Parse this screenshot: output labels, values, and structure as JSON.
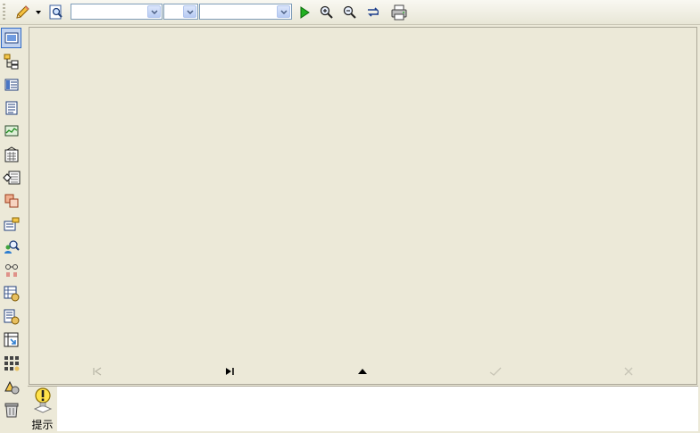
{
  "toolbar": {
    "combo1_value": "",
    "combo2_value": "",
    "combo3_value": "",
    "icons": [
      "pencil-icon",
      "dropdown-arrow-icon",
      "preview-icon",
      "run-icon",
      "zoom-in-icon",
      "zoom-out-icon",
      "refresh-icon",
      "print-icon"
    ]
  },
  "sidebar": {
    "icons": [
      "form-view-icon",
      "tree-view-icon",
      "list-view-icon",
      "document-icon",
      "chart-icon",
      "report-icon",
      "export-icon",
      "layers-icon",
      "properties-icon",
      "search-users-icon",
      "link-icon",
      "grid-settings-icon",
      "doc-settings-icon",
      "table-pivot-icon",
      "matrix-icon",
      "user-settings-icon",
      "trash-icon"
    ]
  },
  "navigation": {
    "icons": [
      "first-record-icon",
      "last-record-icon",
      "up-icon",
      "confirm-icon",
      "cancel-icon"
    ]
  },
  "hint": {
    "label": "提示"
  },
  "colors": {
    "background": "#ece9d8",
    "border": "#aca899",
    "accent": "#316ac5"
  }
}
